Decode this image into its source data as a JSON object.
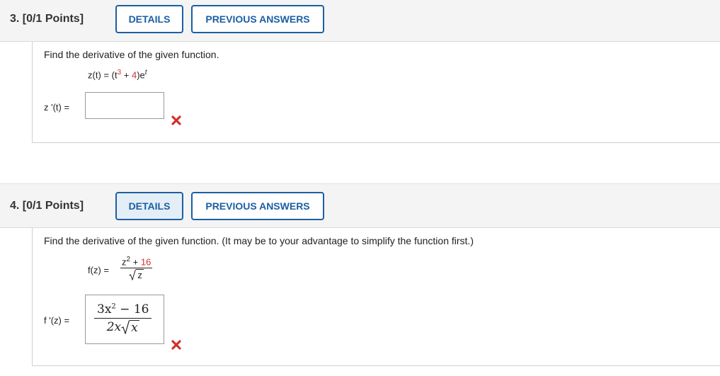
{
  "questions": [
    {
      "number_label": "3.",
      "points_label": "[0/1 Points]",
      "details_label": "DETAILS",
      "prev_label": "PREVIOUS ANSWERS",
      "prompt": "Find the derivative of the given function.",
      "function": {
        "lhs": "z(t)",
        "eq": "=",
        "open": "(t",
        "exp": "3",
        "plus": " + ",
        "red_term": "4",
        "close": ")e",
        "e_exp": "t"
      },
      "answer_label": "z '(t)",
      "answer_eq": "=",
      "answer_value": "",
      "status": "incorrect"
    },
    {
      "number_label": "4.",
      "points_label": "[0/1 Points]",
      "details_label": "DETAILS",
      "prev_label": "PREVIOUS ANSWERS",
      "prompt": "Find the derivative of the given function. (It may be to your advantage to simplify the function first.)",
      "function": {
        "lhs": "f(z)",
        "eq": "=",
        "num_base": "z",
        "num_exp": "2",
        "num_plus": " + ",
        "num_red": "16",
        "den_radicand": "z"
      },
      "answer_label": "f '(z)",
      "answer_eq": "=",
      "answer": {
        "num_coef": "3x",
        "num_exp": "2",
        "num_rest": " − 16",
        "den_coef": "2x",
        "den_radicand": "x"
      },
      "status": "incorrect"
    }
  ],
  "colors": {
    "accent": "#1c5fa3",
    "incorrect": "#d32f2f",
    "header_bg": "#f4f4f4"
  },
  "icons": {
    "incorrect": "x-mark-icon",
    "radical": "square-root-symbol"
  }
}
